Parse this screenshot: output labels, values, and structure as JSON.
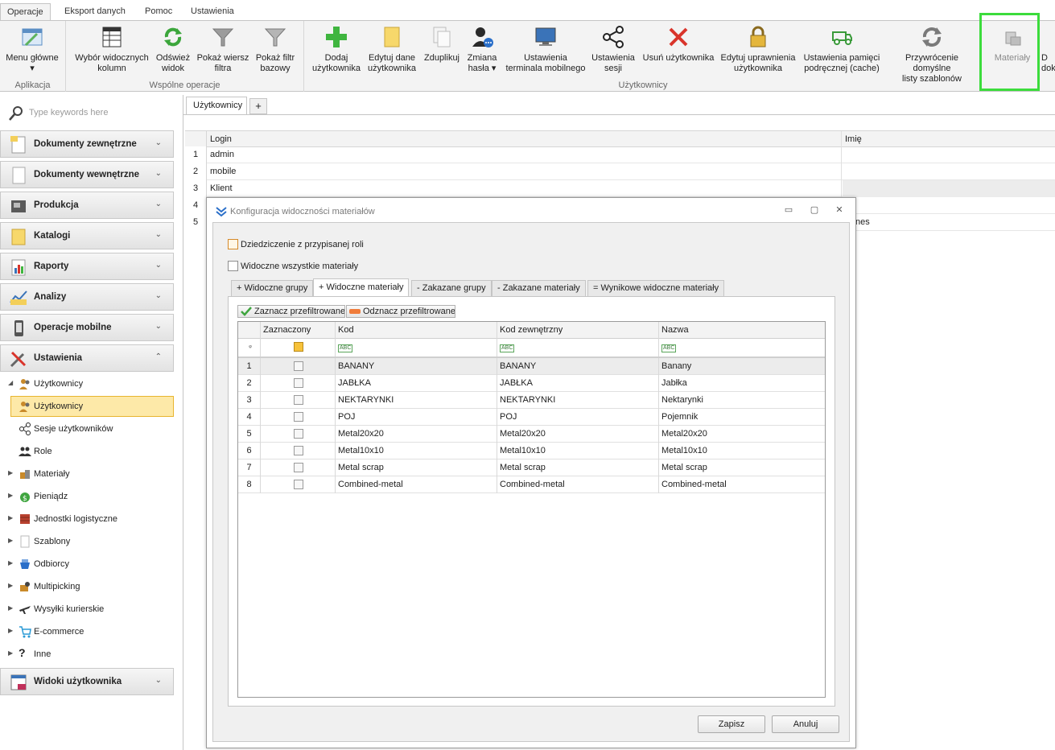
{
  "ribbon_tabs": [
    "Operacje",
    "Eksport danych",
    "Pomoc",
    "Ustawienia"
  ],
  "ribbon": {
    "groups": [
      {
        "label": "Aplikacja"
      },
      {
        "label": "Wspólne operacje"
      },
      {
        "label": "Użytkownicy"
      }
    ],
    "buttons": [
      {
        "label": "Menu główne\n▾"
      },
      {
        "label": "Wybór widocznych\nkolumn"
      },
      {
        "label": "Odśwież\nwidok"
      },
      {
        "label": "Pokaż wiersz\nfiltra"
      },
      {
        "label": "Pokaż filtr\nbazowy"
      },
      {
        "label": "Dodaj\nużytkownika"
      },
      {
        "label": "Edytuj dane\nużytkownika"
      },
      {
        "label": "Zduplikuj"
      },
      {
        "label": "Zmiana\nhasła ▾"
      },
      {
        "label": "Ustawienia\nterminala mobilnego"
      },
      {
        "label": "Ustawienia\nsesji"
      },
      {
        "label": "Usuń użytkownika"
      },
      {
        "label": "Edytuj uprawnienia\nużytkownika"
      },
      {
        "label": "Ustawienia pamięci\npodręcznej (cache)"
      },
      {
        "label": "Przywrócenie domyślne\nlisty szablonów"
      },
      {
        "label": "Materiały"
      },
      {
        "label": "D\ndok"
      }
    ]
  },
  "sidebar": {
    "search_placeholder": "Type keywords here",
    "headers": [
      "Dokumenty zewnętrzne",
      "Dokumenty wewnętrzne",
      "Produkcja",
      "Katalogi",
      "Raporty",
      "Analizy",
      "Operacje mobilne",
      "Ustawienia"
    ],
    "tree": [
      "Użytkownicy",
      "Użytkownicy",
      "Sesje użytkowników",
      "Role",
      "Materiały",
      "Pieniądz",
      "Jednostki logistyczne",
      "Szablony",
      "Odbiorcy",
      "Multipicking",
      "Wysyłki kurierskie",
      "E-commerce",
      "Inne"
    ],
    "footer_header": "Widoki użytkownika"
  },
  "doc_tab": "Użytkownicy",
  "doc_tab_add": "+",
  "users_grid": {
    "columns": [
      "Login",
      "Imię"
    ],
    "rows": [
      {
        "num": "1",
        "login": "admin",
        "imie": ""
      },
      {
        "num": "2",
        "login": "mobile",
        "imie": ""
      },
      {
        "num": "3",
        "login": "Klient",
        "imie": ""
      },
      {
        "num": "4",
        "login": "",
        "imie": ""
      },
      {
        "num": "5",
        "login": "",
        "imie": "nes"
      }
    ]
  },
  "dialog": {
    "title": "Konfiguracja widoczności materiałów",
    "minimize": "▭",
    "restore": "▢",
    "close": "✕",
    "inherit_label": "Dziedziczenie z przypisanej roli",
    "all_visible_label": "Widoczne wszystkie materiały",
    "tabs": [
      "+ Widoczne grupy",
      "+ Widoczne materiały",
      "- Zakazane grupy",
      "- Zakazane materiały",
      "= Wynikowe widoczne materiały"
    ],
    "select_filtered": "Zaznacz przefiltrowane",
    "deselect_filtered": "Odznacz przefiltrowane",
    "grid": {
      "columns": [
        "Zaznaczony",
        "Kod",
        "Kod zewnętrzny",
        "Nazwa"
      ],
      "filter_glyph": "ABC",
      "rows": [
        {
          "num": "1",
          "kod": "BANANY",
          "kod_zew": "BANANY",
          "nazwa": "Banany"
        },
        {
          "num": "2",
          "kod": "JABŁKA",
          "kod_zew": "JABŁKA",
          "nazwa": "Jabłka"
        },
        {
          "num": "3",
          "kod": "NEKTARYNKI",
          "kod_zew": "NEKTARYNKI",
          "nazwa": "Nektarynki"
        },
        {
          "num": "4",
          "kod": "POJ",
          "kod_zew": "POJ",
          "nazwa": "Pojemnik"
        },
        {
          "num": "5",
          "kod": "Metal20x20",
          "kod_zew": "Metal20x20",
          "nazwa": "Metal20x20"
        },
        {
          "num": "6",
          "kod": "Metal10x10",
          "kod_zew": "Metal10x10",
          "nazwa": "Metal10x10"
        },
        {
          "num": "7",
          "kod": "Metal scrap",
          "kod_zew": "Metal scrap",
          "nazwa": "Metal scrap"
        },
        {
          "num": "8",
          "kod": "Combined-metal",
          "kod_zew": "Combined-metal",
          "nazwa": "Combined-metal"
        }
      ]
    },
    "save": "Zapisz",
    "cancel": "Anuluj"
  },
  "colors": {
    "highlight": "#3cdc3c",
    "selected_bg": "#fde9a8",
    "selected_border": "#e8b52f"
  }
}
